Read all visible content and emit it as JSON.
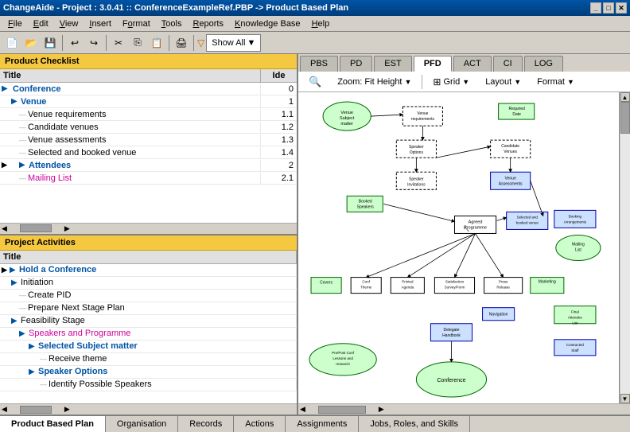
{
  "titleBar": {
    "title": "ChangeAide - Project : 3.0.41 :: ConferenceExampleRef.PBP -> Product Based Plan"
  },
  "menuBar": {
    "items": [
      {
        "label": "File",
        "underline": "F"
      },
      {
        "label": "Edit",
        "underline": "E"
      },
      {
        "label": "View",
        "underline": "V"
      },
      {
        "label": "Insert",
        "underline": "I"
      },
      {
        "label": "Format",
        "underline": "o"
      },
      {
        "label": "Tools",
        "underline": "T"
      },
      {
        "label": "Reports",
        "underline": "R"
      },
      {
        "label": "Knowledge Base",
        "underline": "K"
      },
      {
        "label": "Help",
        "underline": "H"
      }
    ]
  },
  "toolbar": {
    "showAll": "Show All"
  },
  "leftPanel": {
    "productChecklist": {
      "title": "Product Checklist",
      "columns": {
        "title": "Title",
        "id": "Ide"
      },
      "rows": [
        {
          "level": 0,
          "type": "blue",
          "expand": "▶",
          "label": "Conference",
          "id": "0",
          "hasArrow": false
        },
        {
          "level": 1,
          "type": "blue",
          "expand": "▶",
          "label": "Venue",
          "id": "1",
          "hasArrow": false
        },
        {
          "level": 2,
          "type": "normal",
          "expand": "",
          "label": "Venue requirements",
          "id": "1.1",
          "hasArrow": false
        },
        {
          "level": 2,
          "type": "normal",
          "expand": "",
          "label": "Candidate venues",
          "id": "1.2",
          "hasArrow": false
        },
        {
          "level": 2,
          "type": "normal",
          "expand": "",
          "label": "Venue assessments",
          "id": "1.3",
          "hasArrow": false
        },
        {
          "level": 2,
          "type": "normal",
          "expand": "",
          "label": "Selected and booked venue",
          "id": "1.4",
          "hasArrow": false
        },
        {
          "level": 1,
          "type": "blue",
          "expand": "▶",
          "label": "Attendees",
          "id": "2",
          "hasArrow": true
        },
        {
          "level": 2,
          "type": "pink",
          "expand": "",
          "label": "Mailing List",
          "id": "2.1",
          "hasArrow": false
        }
      ]
    },
    "projectActivities": {
      "title": "Project Activities",
      "columns": {
        "title": "Title"
      },
      "rows": [
        {
          "level": 0,
          "type": "blue",
          "expand": "▶",
          "label": "Hold a Conference",
          "id": "",
          "hasArrow": true
        },
        {
          "level": 1,
          "type": "normal",
          "expand": "▶",
          "label": "Initiation",
          "id": ""
        },
        {
          "level": 2,
          "type": "normal",
          "expand": "",
          "label": "Create PID",
          "id": ""
        },
        {
          "level": 2,
          "type": "normal",
          "expand": "",
          "label": "Prepare Next Stage Plan",
          "id": ""
        },
        {
          "level": 1,
          "type": "normal",
          "expand": "▶",
          "label": "Feasibility Stage",
          "id": ""
        },
        {
          "level": 2,
          "type": "pink",
          "expand": "▶",
          "label": "Speakers and Programme",
          "id": ""
        },
        {
          "level": 3,
          "type": "blue",
          "expand": "▶",
          "label": "Selected Subject matter",
          "id": ""
        },
        {
          "level": 4,
          "type": "normal",
          "expand": "",
          "label": "Receive theme",
          "id": ""
        },
        {
          "level": 3,
          "type": "blue",
          "expand": "▶",
          "label": "Speaker Options",
          "id": ""
        },
        {
          "level": 4,
          "type": "normal",
          "expand": "",
          "label": "Identify Possible Speakers",
          "id": ""
        }
      ]
    }
  },
  "rightPanel": {
    "tabs": [
      {
        "label": "PBS",
        "active": false
      },
      {
        "label": "PD",
        "active": false
      },
      {
        "label": "EST",
        "active": false
      },
      {
        "label": "PFD",
        "active": true
      },
      {
        "label": "ACT",
        "active": false
      },
      {
        "label": "CI",
        "active": false
      },
      {
        "label": "LOG",
        "active": false
      }
    ],
    "diagramToolbar": {
      "zoomLabel": "Zoom: Fit Height",
      "gridLabel": "Grid",
      "layoutLabel": "Layout",
      "formatLabel": "Format"
    }
  },
  "statusBar": {
    "tabs": [
      {
        "label": "Product Based Plan",
        "active": true
      },
      {
        "label": "Organisation",
        "active": false
      },
      {
        "label": "Records",
        "active": false
      },
      {
        "label": "Actions",
        "active": false
      },
      {
        "label": "Assignments",
        "active": false
      },
      {
        "label": "Jobs, Roles, and Skills",
        "active": false
      }
    ]
  }
}
